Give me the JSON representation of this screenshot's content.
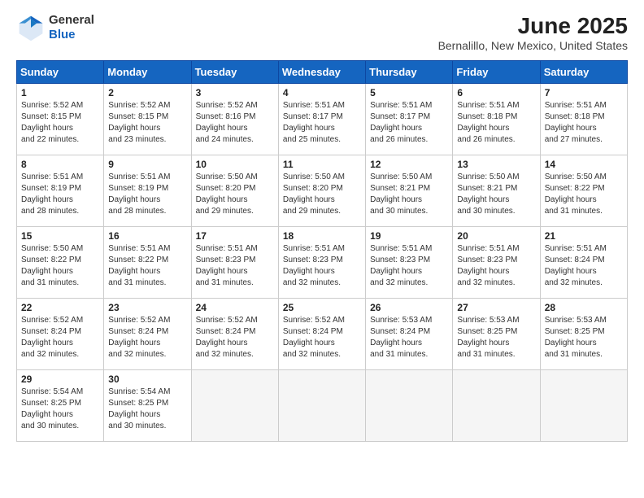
{
  "header": {
    "logo": {
      "line1": "General",
      "line2": "Blue"
    },
    "title": "June 2025",
    "subtitle": "Bernalillo, New Mexico, United States"
  },
  "calendar": {
    "days_of_week": [
      "Sunday",
      "Monday",
      "Tuesday",
      "Wednesday",
      "Thursday",
      "Friday",
      "Saturday"
    ],
    "weeks": [
      [
        {
          "day": "1",
          "sunrise": "5:52 AM",
          "sunset": "8:15 PM",
          "daylight": "14 hours and 22 minutes."
        },
        {
          "day": "2",
          "sunrise": "5:52 AM",
          "sunset": "8:15 PM",
          "daylight": "14 hours and 23 minutes."
        },
        {
          "day": "3",
          "sunrise": "5:52 AM",
          "sunset": "8:16 PM",
          "daylight": "14 hours and 24 minutes."
        },
        {
          "day": "4",
          "sunrise": "5:51 AM",
          "sunset": "8:17 PM",
          "daylight": "14 hours and 25 minutes."
        },
        {
          "day": "5",
          "sunrise": "5:51 AM",
          "sunset": "8:17 PM",
          "daylight": "14 hours and 26 minutes."
        },
        {
          "day": "6",
          "sunrise": "5:51 AM",
          "sunset": "8:18 PM",
          "daylight": "14 hours and 26 minutes."
        },
        {
          "day": "7",
          "sunrise": "5:51 AM",
          "sunset": "8:18 PM",
          "daylight": "14 hours and 27 minutes."
        }
      ],
      [
        {
          "day": "8",
          "sunrise": "5:51 AM",
          "sunset": "8:19 PM",
          "daylight": "14 hours and 28 minutes."
        },
        {
          "day": "9",
          "sunrise": "5:51 AM",
          "sunset": "8:19 PM",
          "daylight": "14 hours and 28 minutes."
        },
        {
          "day": "10",
          "sunrise": "5:50 AM",
          "sunset": "8:20 PM",
          "daylight": "14 hours and 29 minutes."
        },
        {
          "day": "11",
          "sunrise": "5:50 AM",
          "sunset": "8:20 PM",
          "daylight": "14 hours and 29 minutes."
        },
        {
          "day": "12",
          "sunrise": "5:50 AM",
          "sunset": "8:21 PM",
          "daylight": "14 hours and 30 minutes."
        },
        {
          "day": "13",
          "sunrise": "5:50 AM",
          "sunset": "8:21 PM",
          "daylight": "14 hours and 30 minutes."
        },
        {
          "day": "14",
          "sunrise": "5:50 AM",
          "sunset": "8:22 PM",
          "daylight": "14 hours and 31 minutes."
        }
      ],
      [
        {
          "day": "15",
          "sunrise": "5:50 AM",
          "sunset": "8:22 PM",
          "daylight": "14 hours and 31 minutes."
        },
        {
          "day": "16",
          "sunrise": "5:51 AM",
          "sunset": "8:22 PM",
          "daylight": "14 hours and 31 minutes."
        },
        {
          "day": "17",
          "sunrise": "5:51 AM",
          "sunset": "8:23 PM",
          "daylight": "14 hours and 31 minutes."
        },
        {
          "day": "18",
          "sunrise": "5:51 AM",
          "sunset": "8:23 PM",
          "daylight": "14 hours and 32 minutes."
        },
        {
          "day": "19",
          "sunrise": "5:51 AM",
          "sunset": "8:23 PM",
          "daylight": "14 hours and 32 minutes."
        },
        {
          "day": "20",
          "sunrise": "5:51 AM",
          "sunset": "8:23 PM",
          "daylight": "14 hours and 32 minutes."
        },
        {
          "day": "21",
          "sunrise": "5:51 AM",
          "sunset": "8:24 PM",
          "daylight": "14 hours and 32 minutes."
        }
      ],
      [
        {
          "day": "22",
          "sunrise": "5:52 AM",
          "sunset": "8:24 PM",
          "daylight": "14 hours and 32 minutes."
        },
        {
          "day": "23",
          "sunrise": "5:52 AM",
          "sunset": "8:24 PM",
          "daylight": "14 hours and 32 minutes."
        },
        {
          "day": "24",
          "sunrise": "5:52 AM",
          "sunset": "8:24 PM",
          "daylight": "14 hours and 32 minutes."
        },
        {
          "day": "25",
          "sunrise": "5:52 AM",
          "sunset": "8:24 PM",
          "daylight": "14 hours and 32 minutes."
        },
        {
          "day": "26",
          "sunrise": "5:53 AM",
          "sunset": "8:24 PM",
          "daylight": "14 hours and 31 minutes."
        },
        {
          "day": "27",
          "sunrise": "5:53 AM",
          "sunset": "8:25 PM",
          "daylight": "14 hours and 31 minutes."
        },
        {
          "day": "28",
          "sunrise": "5:53 AM",
          "sunset": "8:25 PM",
          "daylight": "14 hours and 31 minutes."
        }
      ],
      [
        {
          "day": "29",
          "sunrise": "5:54 AM",
          "sunset": "8:25 PM",
          "daylight": "14 hours and 30 minutes."
        },
        {
          "day": "30",
          "sunrise": "5:54 AM",
          "sunset": "8:25 PM",
          "daylight": "14 hours and 30 minutes."
        },
        null,
        null,
        null,
        null,
        null
      ]
    ]
  }
}
